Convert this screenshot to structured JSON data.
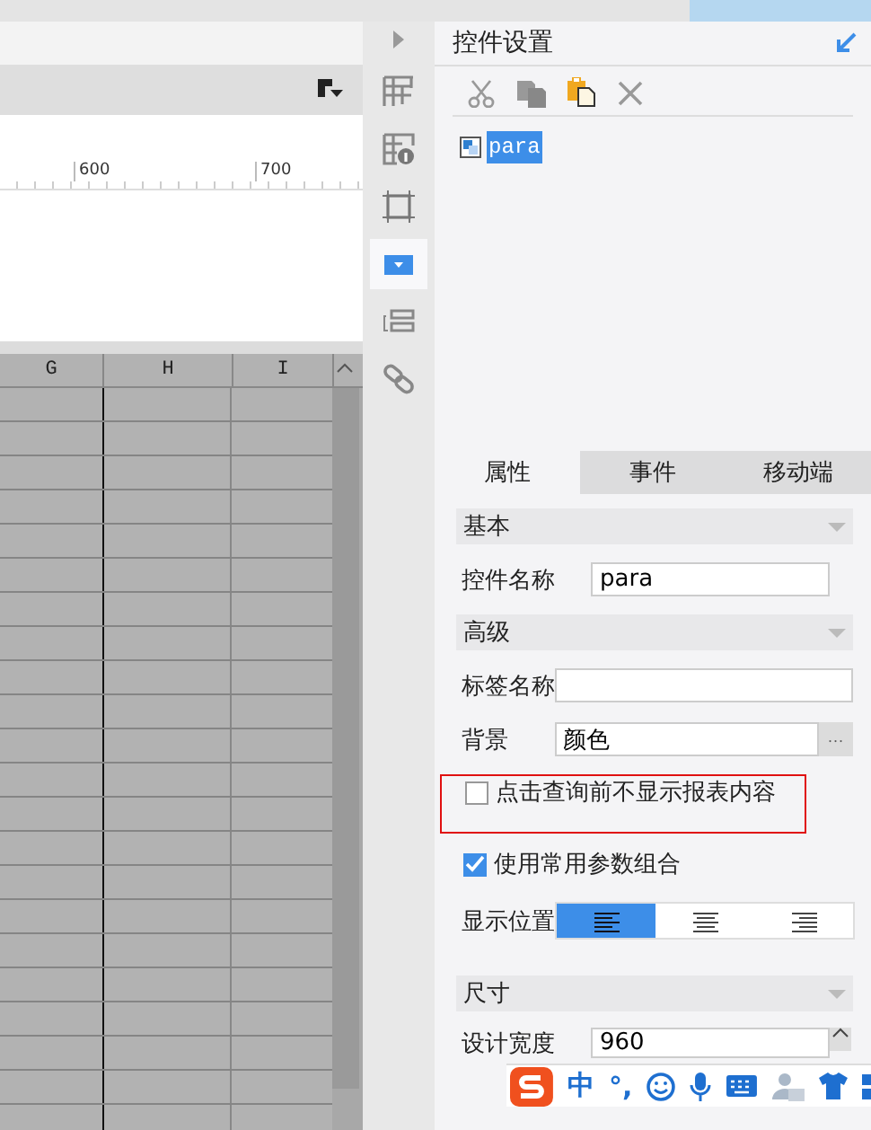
{
  "ruler": {
    "ticks": [
      "600",
      "700"
    ]
  },
  "sheet": {
    "columns": [
      "G",
      "H",
      "I"
    ]
  },
  "side_tools": [
    {
      "selected": false
    },
    {
      "selected": false
    },
    {
      "selected": false
    },
    {
      "selected": true
    },
    {
      "selected": false
    },
    {
      "selected": false
    }
  ],
  "panel": {
    "title": "控件设置",
    "tree": [
      {
        "label": "para",
        "selected": true
      }
    ]
  },
  "tabs": [
    {
      "label": "属性",
      "selected": true
    },
    {
      "label": "事件",
      "selected": false
    },
    {
      "label": "移动端",
      "selected": false
    }
  ],
  "properties": [
    {
      "kind": "section",
      "label": "基本"
    },
    {
      "kind": "text",
      "label": "控件名称",
      "value": "para"
    },
    {
      "kind": "section",
      "label": "高级"
    },
    {
      "kind": "text",
      "label": "标签名称"
    },
    {
      "kind": "picker",
      "label": "背景",
      "value": "颜色",
      "button": "···"
    },
    {
      "kind": "checkbox",
      "label": "点击查询前不显示报表内容",
      "checked": false,
      "highlighted": true
    },
    {
      "kind": "checkbox",
      "label": "使用常用参数组合",
      "checked": true,
      "highlighted": false
    },
    {
      "kind": "align",
      "label": "显示位置",
      "options": [
        {
          "selected": true
        },
        {
          "selected": false
        },
        {
          "selected": false
        }
      ]
    },
    {
      "kind": "section",
      "label": "尺寸"
    },
    {
      "kind": "number",
      "label": "设计宽度",
      "value": "960"
    }
  ],
  "ime_bar": {
    "lang": "中",
    "punct": "°,"
  }
}
